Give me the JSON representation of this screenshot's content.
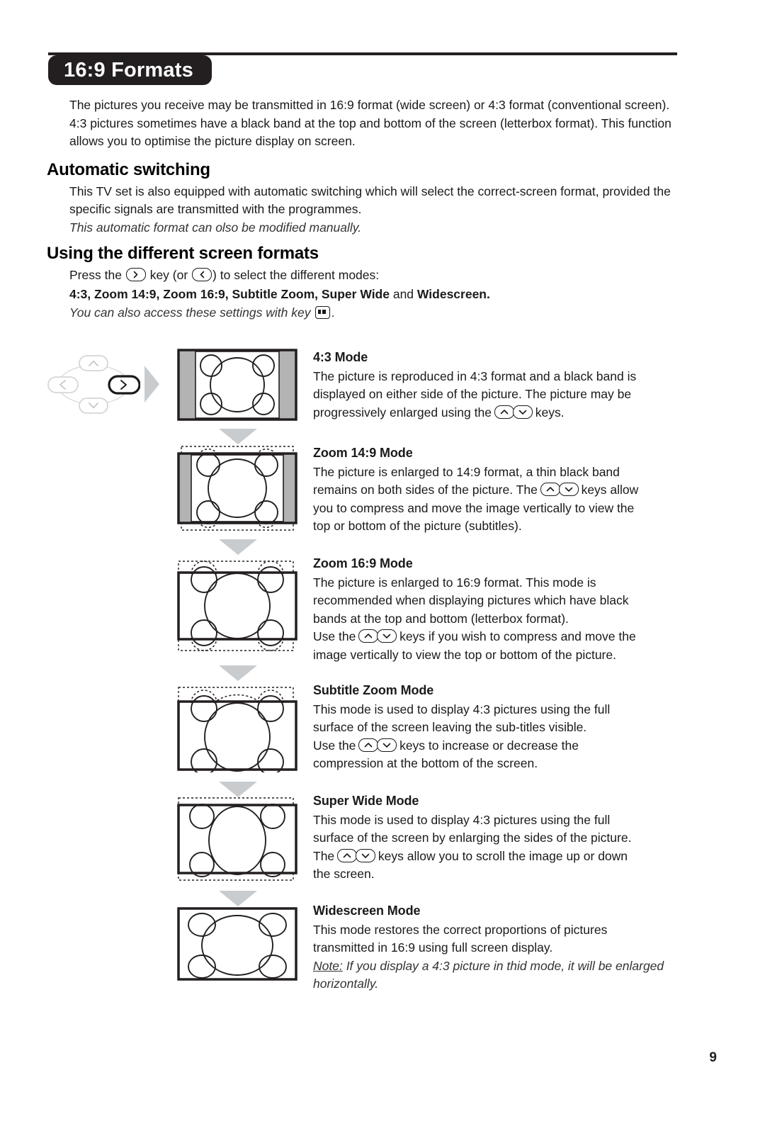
{
  "document": {
    "title": "16:9 Formats",
    "page_number": "9",
    "intro": "The pictures you receive may be transmitted in 16:9 format (wide screen) or 4:3 format (conventional screen). 4:3 pictures sometimes have a black band at the top and bottom of the screen (letterbox format). This function allows you to optimise the picture display on screen."
  },
  "automatic_switching": {
    "heading": "Automatic switching",
    "body": "This TV set is also equipped with automatic switching which will select the correct-screen format, provided the specific signals are transmitted with the programmes.",
    "italic_note": "This automatic format can olso be modified manually."
  },
  "using_formats": {
    "heading": "Using the different screen formats",
    "press_prefix": "Press the",
    "press_mid": "key (or",
    "press_suffix": ") to select the different modes:",
    "modes_list_bold": "4:3, Zoom 14:9, Zoom 16:9, Subtitle Zoom, Super Wide",
    "modes_list_and": " and ",
    "modes_list_last": "Widescreen",
    "modes_list_end": ".",
    "access_note_prefix": "You can also access these settings with key",
    "access_note_suffix": "."
  },
  "modes": [
    {
      "title": "4:3 Mode",
      "line1": "The picture is reproduced in 4:3 format and a black band is",
      "line2": "displayed on either side of the picture. The picture may be",
      "line3_prefix": "progressively enlarged using the",
      "line3_suffix": "keys."
    },
    {
      "title": "Zoom 14:9 Mode",
      "line1": "The picture is enlarged to 14:9 format, a thin black band",
      "line2_prefix": "remains on both sides of the picture. The",
      "line2_suffix": "keys allow",
      "line3": "you to compress and move the image vertically to view the",
      "line4": "top or bottom of the picture (subtitles)."
    },
    {
      "title": "Zoom 16:9 Mode",
      "line1": "The picture is enlarged to 16:9 format. This mode is",
      "line2": "recommended when displaying pictures which have black",
      "line3": "bands at the top and bottom (letterbox format).",
      "line4_prefix": "Use the",
      "line4_suffix": "keys if you wish to compress and move the",
      "line5": "image vertically to view the top or bottom of the picture."
    },
    {
      "title": "Subtitle Zoom Mode",
      "line1": "This mode is used to display 4:3 pictures using the full",
      "line2": "surface of the screen leaving the sub-titles visible.",
      "line3_prefix": "Use the",
      "line3_suffix": "keys to increase or decrease the",
      "line4": "compression at the bottom of the screen."
    },
    {
      "title": "Super Wide Mode",
      "line1": "This mode is used to display 4:3 pictures using the full",
      "line2": "surface of the screen by enlarging the sides of the picture.",
      "line3_prefix": "The",
      "line3_suffix": "keys allow you to scroll the image up or down",
      "line4": "the screen."
    },
    {
      "title": "Widescreen Mode",
      "line1": "This mode restores the correct proportions of pictures",
      "line2": "transmitted in 16:9 using full screen display.",
      "note_label": "Note:",
      "note_text": " If you display a 4:3 picture in thid mode, it will be enlarged horizontally."
    }
  ],
  "colors": {
    "ink": "#231f20",
    "band_gray": "#b3b3b3",
    "arrow_gray": "#c9ccce"
  }
}
